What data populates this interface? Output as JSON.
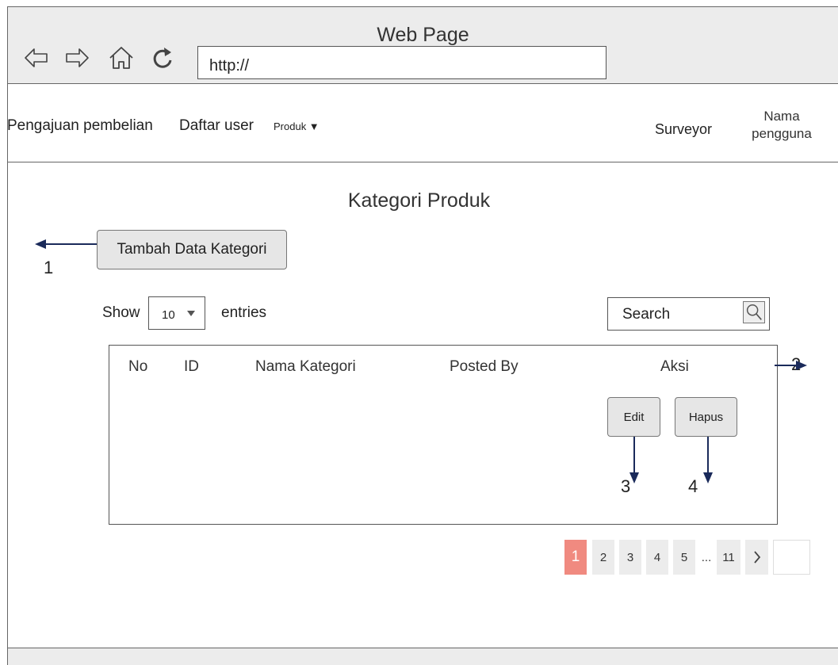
{
  "window": {
    "title": "Web Page",
    "url": "http://"
  },
  "nav_icons": [
    "back-arrow-icon",
    "forward-arrow-icon",
    "home-icon",
    "reload-icon"
  ],
  "menu": {
    "items": [
      "Pengajuan pembelian",
      "Daftar user"
    ],
    "dropdown_label": "Produk ▼",
    "role": "Surveyor",
    "user_line1": "Nama",
    "user_line2": "pengguna"
  },
  "page": {
    "title": "Kategori Produk",
    "add_button": "Tambah Data Kategori"
  },
  "table_controls": {
    "show_label": "Show",
    "entries_value": "10",
    "entries_label": "entries",
    "search_placeholder": "Search"
  },
  "table": {
    "columns": [
      "No",
      "ID",
      "Nama Kategori",
      "Posted By",
      "Aksi"
    ],
    "edit_button": "Edit",
    "delete_button": "Hapus"
  },
  "annotations": {
    "n1": "1",
    "n2": "2",
    "n3": "3",
    "n4": "4"
  },
  "pagination": {
    "pages": [
      "1",
      "2",
      "3",
      "4",
      "5",
      "...",
      "11"
    ],
    "next_icon": "chevron-right-icon",
    "active_page": "1"
  },
  "colors": {
    "active_page": "#f08a80",
    "arrow": "#1a2a5a"
  }
}
